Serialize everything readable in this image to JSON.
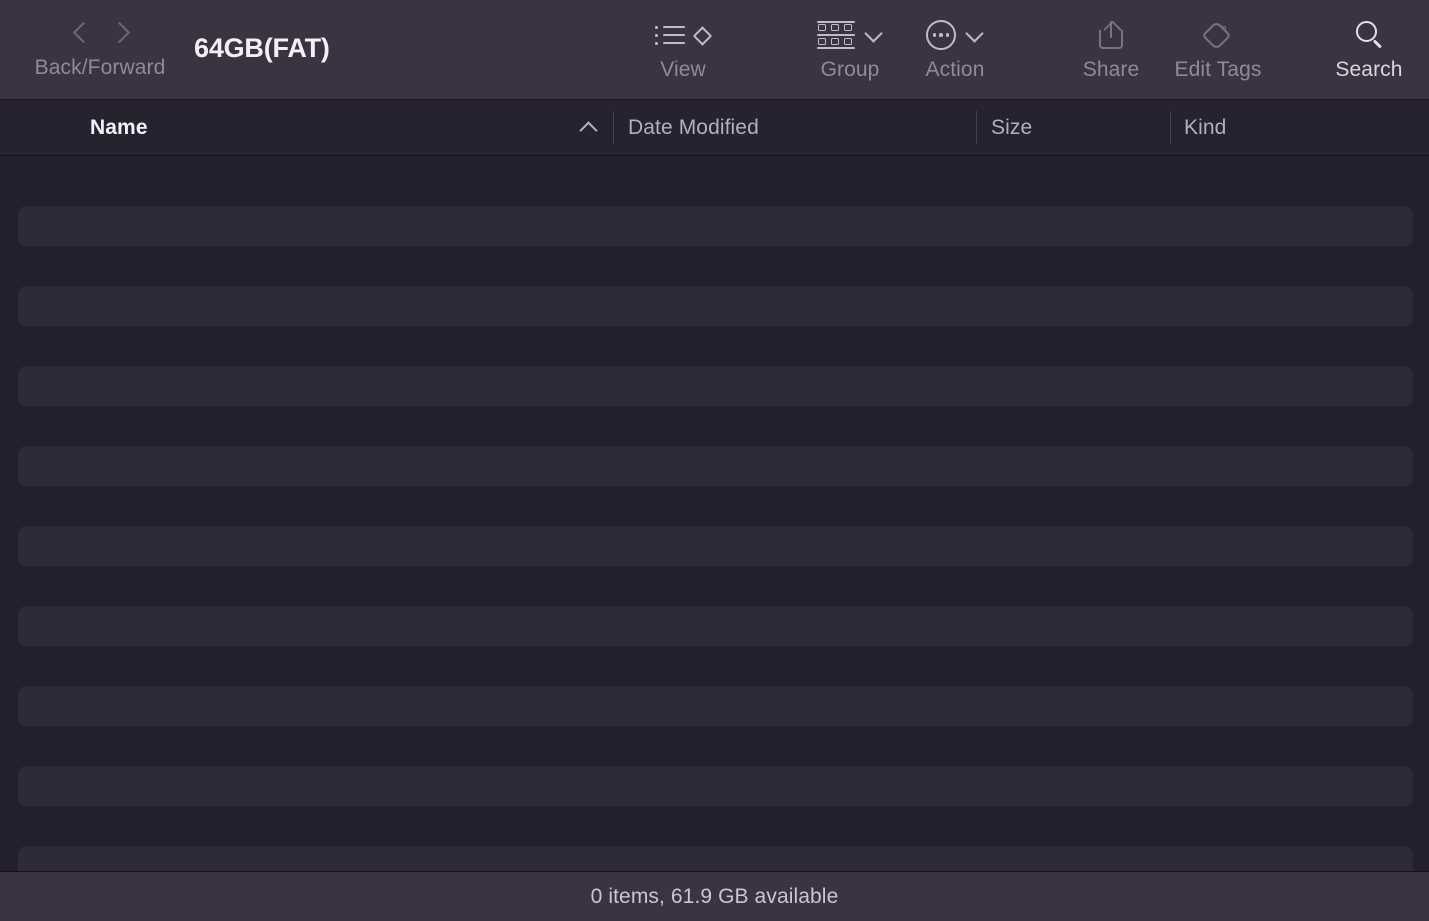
{
  "window": {
    "title": "64GB(FAT)"
  },
  "toolbar": {
    "nav": {
      "label": "Back/Forward",
      "back_icon": "chevron-left-icon",
      "forward_icon": "chevron-right-icon"
    },
    "view": {
      "label": "View",
      "icon": "list-view-icon",
      "stepper_icon": "up-down-chevron-icon"
    },
    "group": {
      "label": "Group",
      "icon": "group-grid-icon",
      "chevron_icon": "chevron-down-icon"
    },
    "action": {
      "label": "Action",
      "icon": "ellipsis-circle-icon",
      "chevron_icon": "chevron-down-icon"
    },
    "share": {
      "label": "Share",
      "icon": "share-icon",
      "enabled": false
    },
    "edit_tags": {
      "label": "Edit Tags",
      "icon": "tag-icon",
      "enabled": false
    },
    "search": {
      "label": "Search",
      "icon": "search-icon",
      "enabled": true
    }
  },
  "columns": [
    {
      "key": "name",
      "label": "Name",
      "sorted": true,
      "sort_direction": "ascending"
    },
    {
      "key": "date_modified",
      "label": "Date Modified",
      "sorted": false
    },
    {
      "key": "size",
      "label": "Size",
      "sorted": false
    },
    {
      "key": "kind",
      "label": "Kind",
      "sorted": false
    }
  ],
  "file_list": {
    "rows": [],
    "empty": true,
    "placeholder_stripe_count": 9
  },
  "status_bar": {
    "text": "0 items, 61.9 GB available",
    "item_count": 0,
    "available_space": "61.9 GB"
  },
  "colors": {
    "toolbar_bg": "#3a3442",
    "header_bg": "#262230",
    "list_bg": "#241f2d",
    "stripe_bg": "#2e2a38",
    "text_bright": "#f2f0f5",
    "text_dim": "#8e8a97"
  }
}
